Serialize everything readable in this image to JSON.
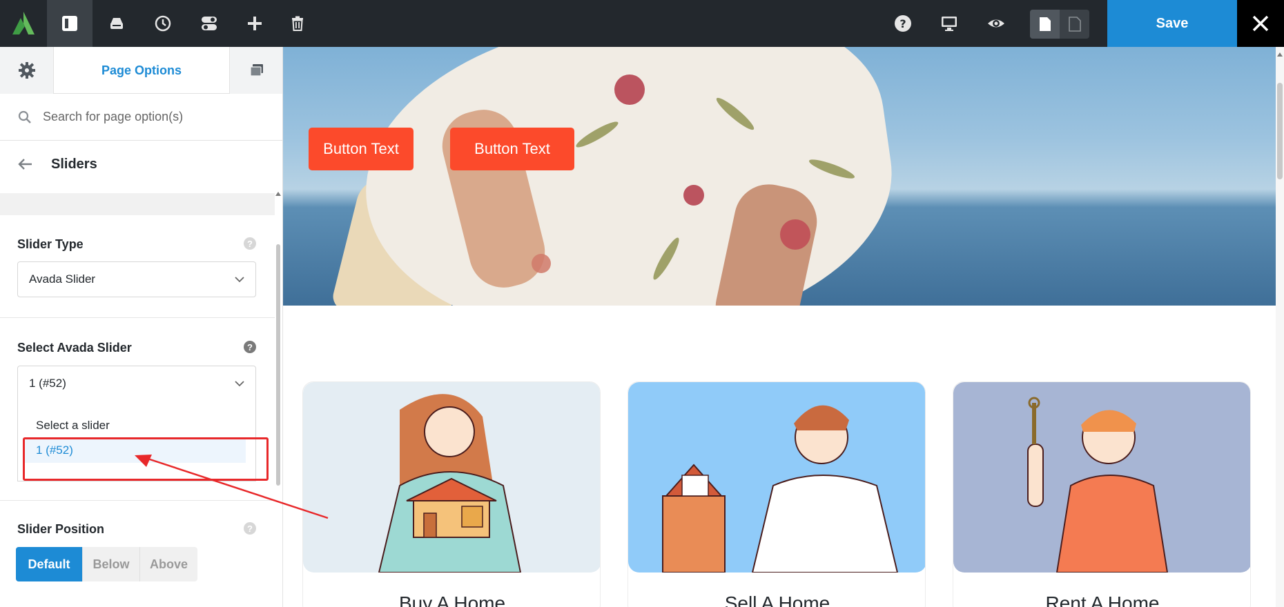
{
  "toolbar": {
    "save_label": "Save"
  },
  "sidebar": {
    "active_tab_label": "Page Options",
    "search": {
      "placeholder": "Search for page option(s)",
      "value": ""
    },
    "section_title": "Sliders",
    "slider_type": {
      "label": "Slider Type",
      "value": "Avada Slider"
    },
    "select_slider": {
      "label": "Select Avada Slider",
      "value": "1 (#52)",
      "options": [
        "Select a slider",
        "1 (#52)"
      ],
      "selected_index": 1
    },
    "slider_position": {
      "label": "Slider Position",
      "options": [
        "Default",
        "Below",
        "Above"
      ],
      "selected": "Default"
    }
  },
  "preview": {
    "hero_buttons": [
      "Button Text",
      "Button Text"
    ],
    "cards": [
      {
        "title": "Buy A Home",
        "bg": "#e4edf3"
      },
      {
        "title": "Sell A Home",
        "bg": "#90cbf9"
      },
      {
        "title": "Rent A Home",
        "bg": "#a7b5d4"
      }
    ]
  },
  "colors": {
    "accent": "#1d8bd5",
    "topbar": "#23282d",
    "hero_button": "#fc4a2b",
    "annotation": "#e8282a"
  },
  "icons": {
    "logo": "avada-logo-icon",
    "toolbar": [
      "sidebar-toggle-icon",
      "library-icon",
      "history-icon",
      "toggle-icon",
      "add-icon",
      "trash-icon",
      "help-icon",
      "desktop-icon",
      "eye-icon",
      "page-icon",
      "page-outline-icon",
      "close-icon"
    ]
  }
}
